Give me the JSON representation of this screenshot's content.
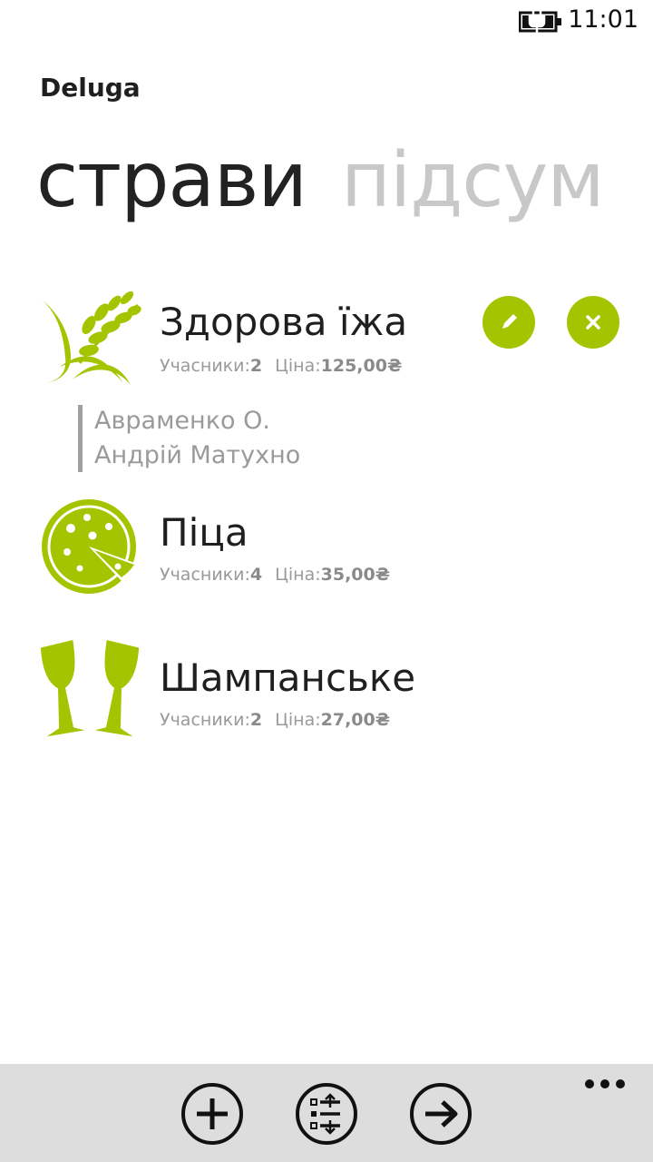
{
  "status": {
    "time": "11:01",
    "battery_icon": "battery-charging-icon"
  },
  "app": {
    "title": "Deluga"
  },
  "pivot": {
    "items": [
      "страви",
      "підсум"
    ],
    "active_index": 0
  },
  "accent": "#a5c400",
  "dishes": [
    {
      "name": "Здорова їжа",
      "icon": "wheat-icon",
      "participants_label": "Учасники:",
      "participants_count": "2",
      "price_label": "Ціна:",
      "price_value": "125,00₴",
      "expanded": true,
      "participants": [
        "Авраменко О.",
        "Андрій Матухно"
      ]
    },
    {
      "name": "Піца",
      "icon": "pizza-icon",
      "participants_label": "Учасники:",
      "participants_count": "4",
      "price_label": "Ціна:",
      "price_value": "35,00₴"
    },
    {
      "name": "Шампанське",
      "icon": "champagne-icon",
      "participants_label": "Учасники:",
      "participants_count": "2",
      "price_label": "Ціна:",
      "price_value": "27,00₴"
    }
  ],
  "app_bar": {
    "buttons": [
      "add-icon",
      "sort-list-icon",
      "next-arrow-icon"
    ],
    "more": "more-dots-icon"
  }
}
